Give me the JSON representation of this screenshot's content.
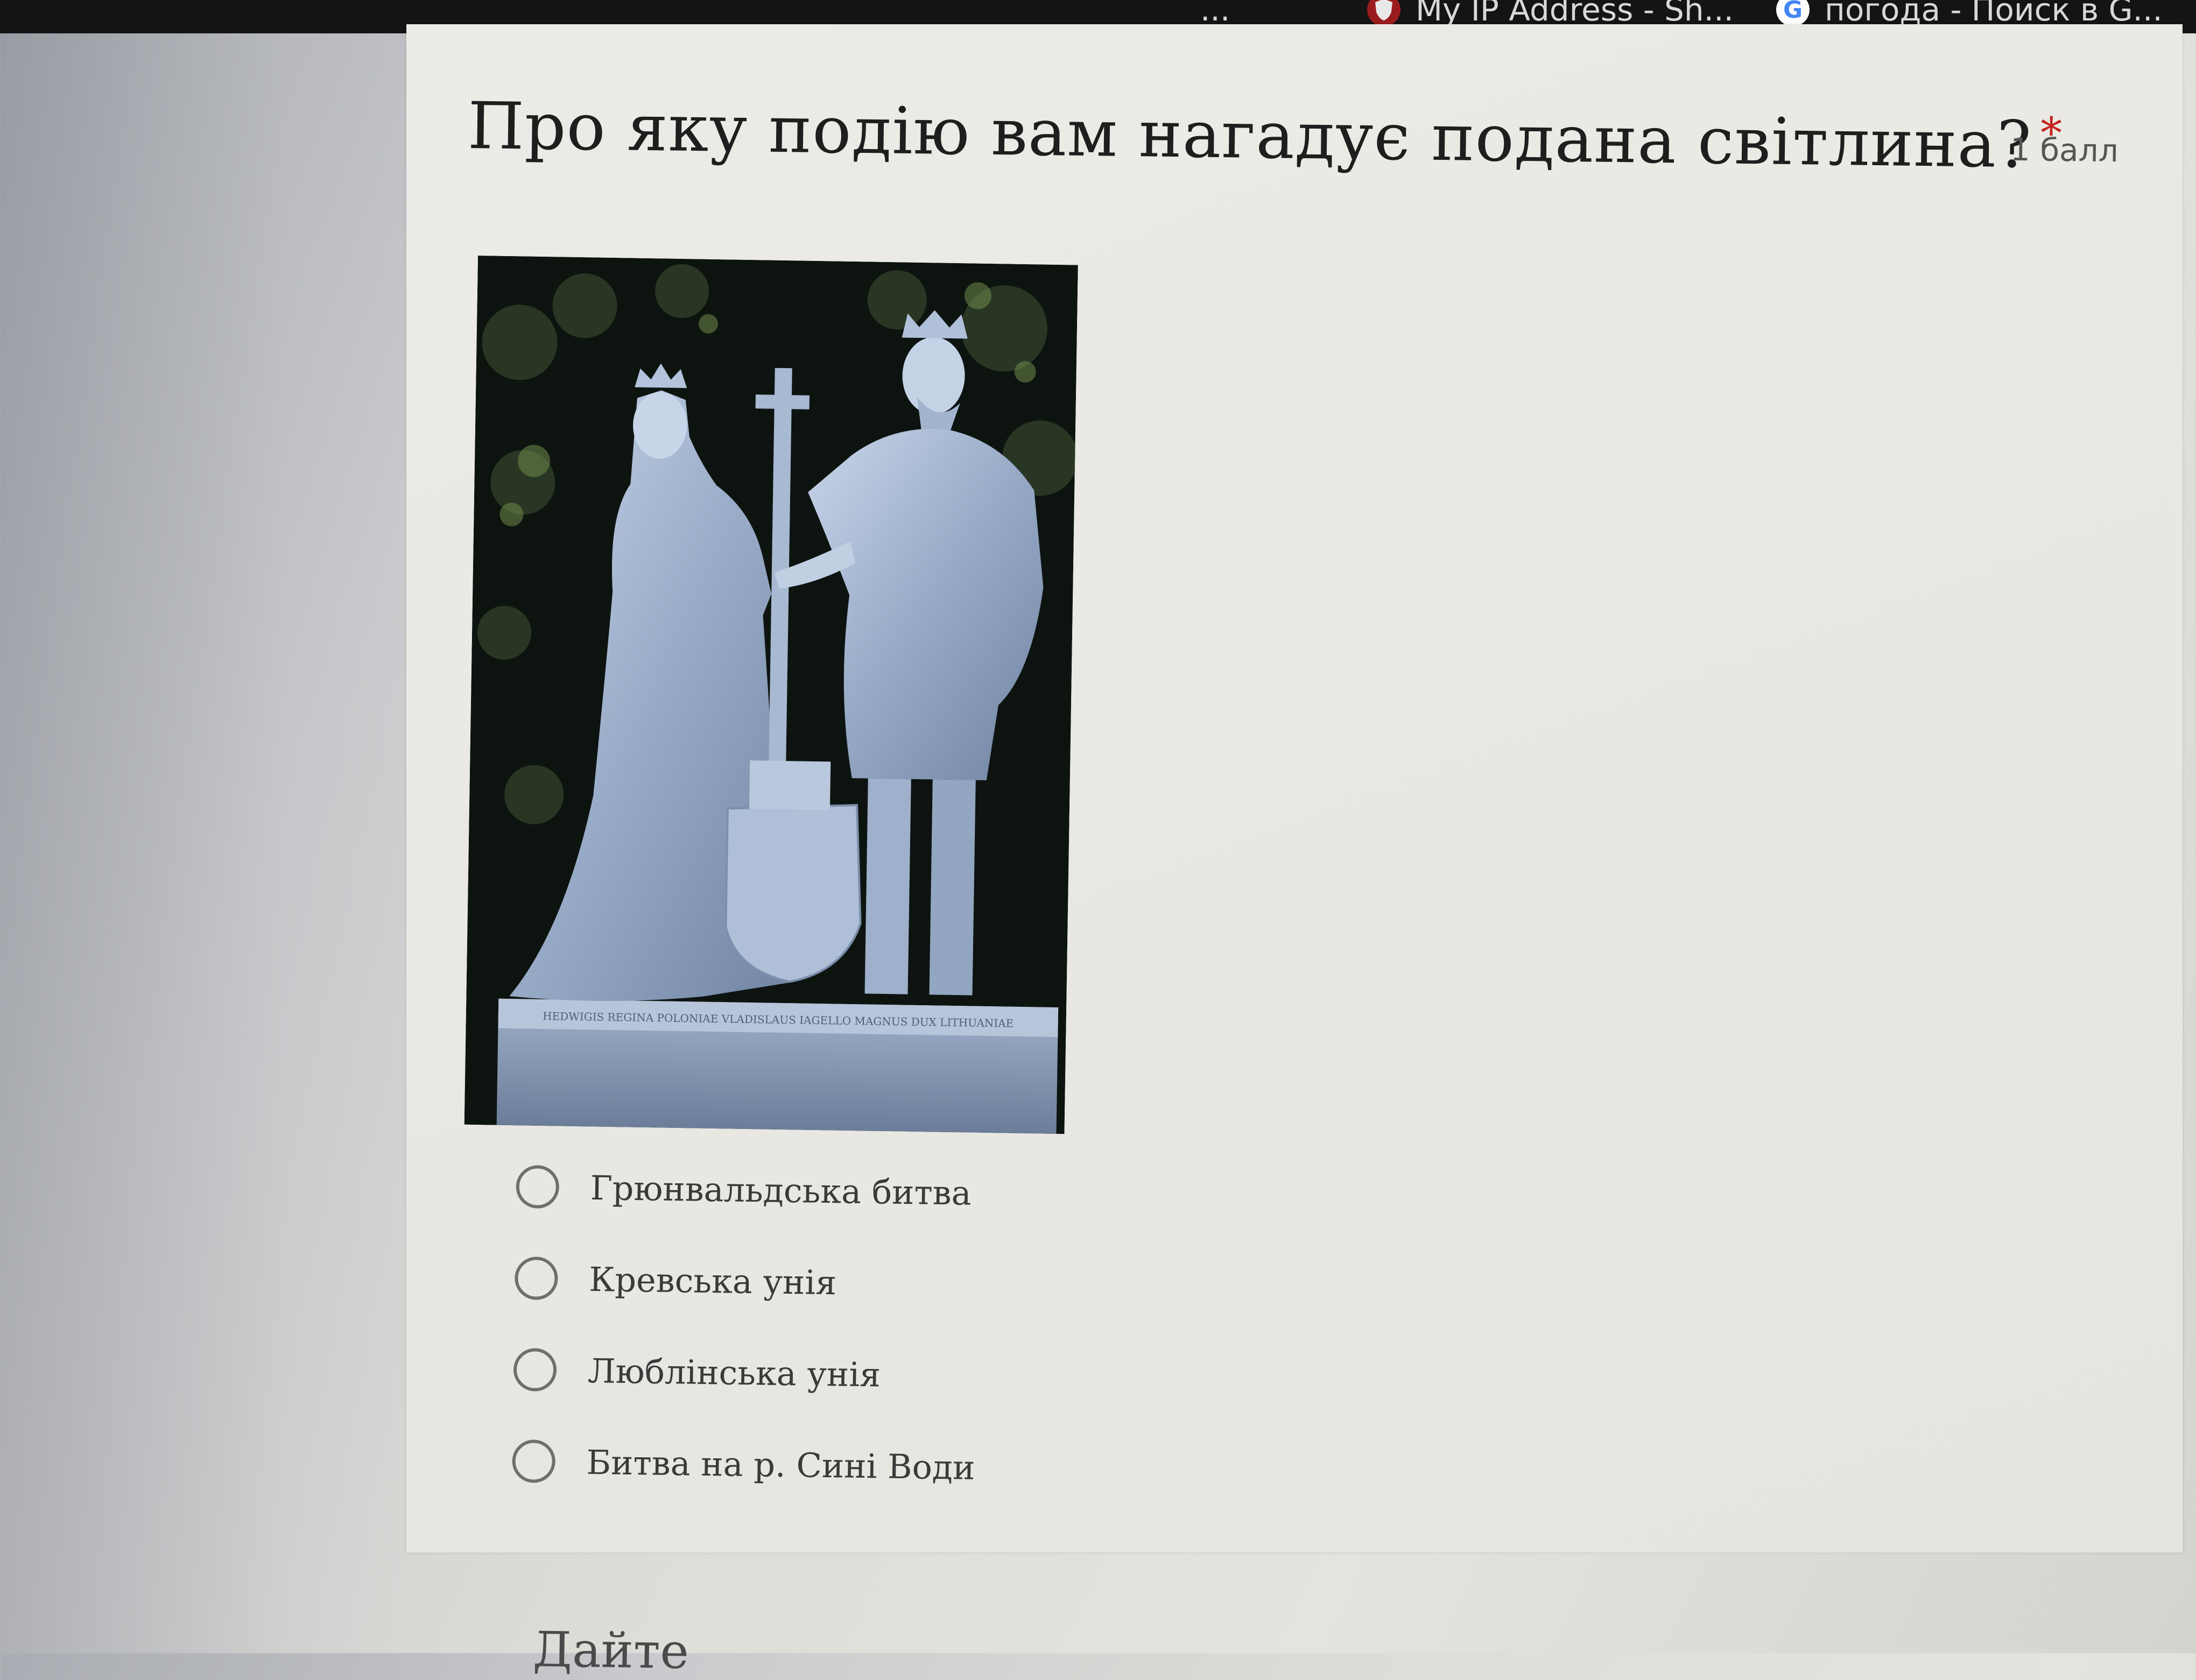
{
  "bookmarks": [
    {
      "label": "...",
      "icon": "bookmark-icon"
    },
    {
      "label": "My IP Address - Sh...",
      "icon": "shield-icon"
    },
    {
      "label": "погода - Поиск в G...",
      "icon": "google-icon",
      "icon_text": "G"
    }
  ],
  "question": {
    "text": "Про яку подію вам нагадує подана світлина?",
    "required_mark": "*",
    "points": "1 балл"
  },
  "image": {
    "icon": "statue-photo",
    "plaque_text": "HEDWIGIS REGINA POLONIAE  VLADISLAUS IAGELLO MAGNUS DUX LITHUANIAE"
  },
  "options": [
    {
      "label": "Грюнвальдська битва",
      "selected": false
    },
    {
      "label": "Кревська унія",
      "selected": false
    },
    {
      "label": "Люблінська унія",
      "selected": false
    },
    {
      "label": "Битва на р. Сині Води",
      "selected": false
    }
  ],
  "next_question_partial": "Дайте"
}
